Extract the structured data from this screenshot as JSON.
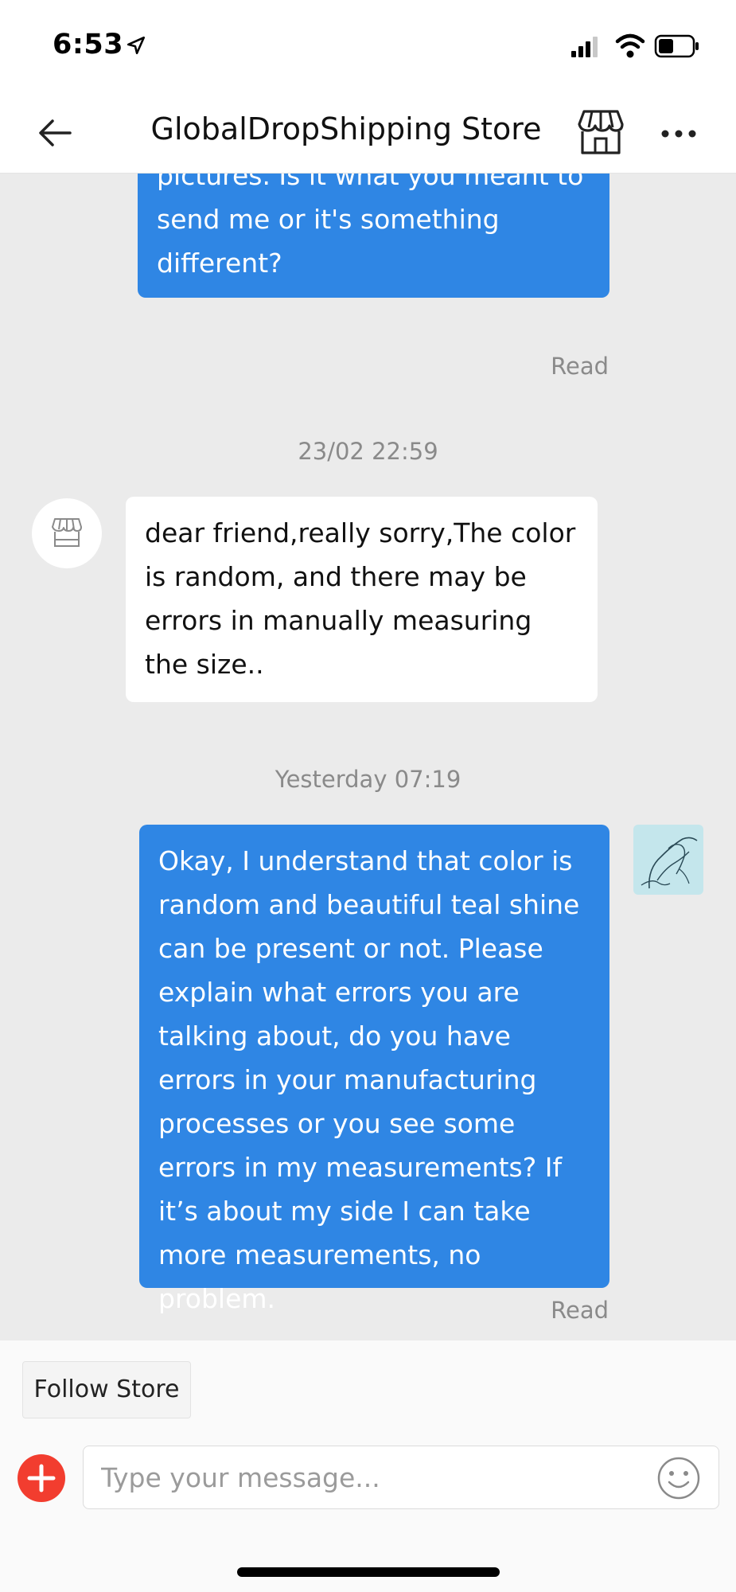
{
  "status_bar": {
    "time": "6:53",
    "icons": [
      "location-arrow-icon",
      "cellular-signal-icon",
      "wifi-icon",
      "battery-icon"
    ]
  },
  "header": {
    "title": "GlobalDropShipping Store",
    "back_icon": "arrow-left-icon",
    "store_icon": "storefront-icon",
    "more_icon": "more-dots-icon"
  },
  "messages": [
    {
      "direction": "outgoing",
      "text": "shiny teal what you show in the pictures. Is it what you meant to send me or it's something different?",
      "status": "Read"
    },
    {
      "timestamp": "23/02 22:59"
    },
    {
      "direction": "incoming",
      "text": "dear friend,really sorry,The color is random, and there may be errors in manually measuring the size.."
    },
    {
      "timestamp": "Yesterday 07:19"
    },
    {
      "direction": "outgoing",
      "text": "Okay, I understand that color is random and beautiful teal shine can be present or not. Please explain what errors you are talking about, do you have errors in your manufacturing processes or you see some errors in my measurements? If it’s about my side I can take more measurements, no problem.",
      "status": "Read"
    }
  ],
  "footer": {
    "follow_label": "Follow Store",
    "input_placeholder": "Type your message...",
    "plus_icon": "plus-circle-icon",
    "emoji_icon": "smiley-icon"
  },
  "colors": {
    "outgoing_bubble": "#2f86e4",
    "incoming_bubble": "#ffffff",
    "chat_background": "#ebebeb",
    "plus_button": "#f23d2f"
  }
}
